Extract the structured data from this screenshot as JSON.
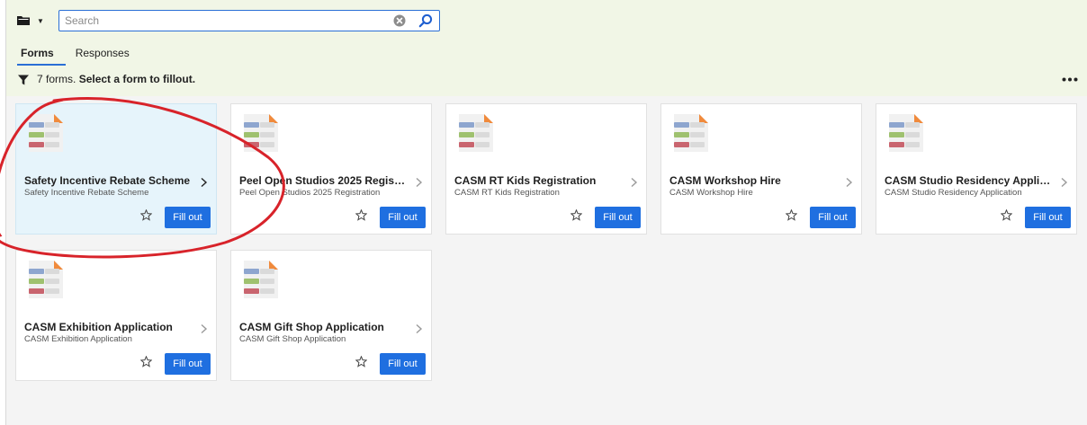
{
  "toolbar": {
    "folder_icon": "folder-icon",
    "search_placeholder": "Search",
    "search_value": ""
  },
  "tabs": [
    {
      "label": "Forms",
      "active": true
    },
    {
      "label": "Responses",
      "active": false
    }
  ],
  "summary": {
    "count_text": "7 forms.",
    "instruction": "Select a form to fillout."
  },
  "cards": [
    {
      "title": "Safety Incentive Rebate Scheme",
      "subtitle": "Safety Incentive Rebate Scheme",
      "button": "Fill out",
      "selected": true
    },
    {
      "title": "Peel Open Studios 2025 Registration",
      "subtitle": "Peel Open Studios 2025 Registration",
      "button": "Fill out",
      "selected": false
    },
    {
      "title": "CASM RT Kids Registration",
      "subtitle": "CASM RT Kids Registration",
      "button": "Fill out",
      "selected": false
    },
    {
      "title": "CASM Workshop Hire",
      "subtitle": "CASM Workshop Hire",
      "button": "Fill out",
      "selected": false
    },
    {
      "title": "CASM Studio Residency Application",
      "subtitle": "CASM Studio Residency Application",
      "button": "Fill out",
      "selected": false
    },
    {
      "title": "CASM Exhibition Application",
      "subtitle": "CASM Exhibition Application",
      "button": "Fill out",
      "selected": false
    },
    {
      "title": "CASM Gift Shop Application",
      "subtitle": "CASM Gift Shop Application",
      "button": "Fill out",
      "selected": false
    }
  ],
  "colors": {
    "accent": "#1f6fe0",
    "header_bg": "#f1f6e6",
    "selected_card_bg": "#e6f4fb",
    "annotation": "#d8232a"
  }
}
